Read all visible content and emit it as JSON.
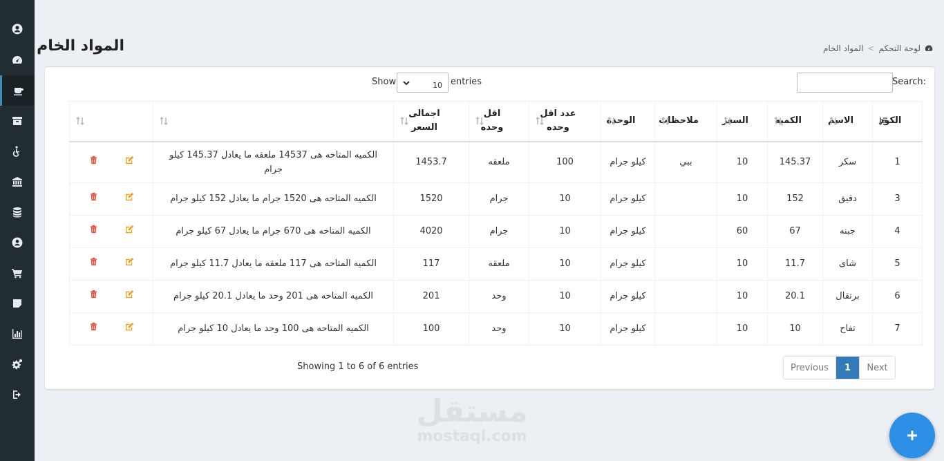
{
  "header": {
    "title": "المواد الخام"
  },
  "breadcrumb": {
    "home": "لوحة التحكم",
    "separator": ">",
    "current": "المواد الخام"
  },
  "sidebar": {
    "items": [
      {
        "icon": "user-circle-icon"
      },
      {
        "icon": "dashboard-icon"
      },
      {
        "icon": "coffee-icon",
        "active": true
      },
      {
        "icon": "archive-icon"
      },
      {
        "icon": "wheelchair-icon"
      },
      {
        "icon": "bank-icon"
      },
      {
        "icon": "database-icon"
      },
      {
        "icon": "user-icon"
      },
      {
        "icon": "cart-icon"
      },
      {
        "icon": "note-icon"
      },
      {
        "icon": "bar-chart-icon"
      },
      {
        "icon": "cogs-icon"
      },
      {
        "icon": "sign-out-icon"
      }
    ]
  },
  "controls": {
    "search_label": "Search:",
    "search_value": "",
    "show_label": "Show",
    "length_value": "10",
    "entries_label": "entries"
  },
  "table": {
    "columns": [
      "الكود",
      "الاسم",
      "الكميه",
      "السعر",
      "ملاحظات",
      "الوحده",
      "عدد اقل وحده",
      "اقل وحده",
      "اجمالى السعر",
      "",
      ""
    ],
    "rows": [
      {
        "code": "1",
        "name": "سكر",
        "qty": "145.37",
        "price": "10",
        "notes": "ببي",
        "unit": "كيلو جرام",
        "min_count": "100",
        "min_unit": "ملعقه",
        "total": "1453.7",
        "desc": "الكميه المتاحه هى 14537 ملعقه ما يعادل 145.37 كيلو جرام"
      },
      {
        "code": "3",
        "name": "دقيق",
        "qty": "152",
        "price": "10",
        "notes": "",
        "unit": "كيلو جرام",
        "min_count": "10",
        "min_unit": "جرام",
        "total": "1520",
        "desc": "الكميه المتاحه هى 1520 جرام ما يعادل 152 كيلو جرام"
      },
      {
        "code": "4",
        "name": "جبنه",
        "qty": "67",
        "price": "60",
        "notes": "",
        "unit": "كيلو جرام",
        "min_count": "10",
        "min_unit": "جرام",
        "total": "4020",
        "desc": "الكميه المتاحه هى 670 جرام ما يعادل 67 كيلو جرام"
      },
      {
        "code": "5",
        "name": "شاى",
        "qty": "11.7",
        "price": "10",
        "notes": "",
        "unit": "كيلو جرام",
        "min_count": "10",
        "min_unit": "ملعقه",
        "total": "117",
        "desc": "الكميه المتاحه هى 117 ملعقه ما يعادل 11.7 كيلو جرام"
      },
      {
        "code": "6",
        "name": "برتقال",
        "qty": "20.1",
        "price": "10",
        "notes": "",
        "unit": "كيلو جرام",
        "min_count": "10",
        "min_unit": "وحد",
        "total": "201",
        "desc": "الكميه المتاحه هى 201 وحد ما يعادل 20.1 كيلو جرام"
      },
      {
        "code": "7",
        "name": "تفاح",
        "qty": "10",
        "price": "10",
        "notes": "",
        "unit": "كيلو جرام",
        "min_count": "10",
        "min_unit": "وحد",
        "total": "100",
        "desc": "الكميه المتاحه هى 100 وحد ما يعادل 10 كيلو جرام"
      }
    ]
  },
  "footer": {
    "info": "Showing 1 to 6 of 6 entries",
    "prev": "Previous",
    "current_page": "1",
    "next": "Next"
  },
  "watermark": {
    "ar": "مستقل",
    "en": "mostaql.com"
  },
  "colors": {
    "sidebar": "#222d32",
    "accent": "#337ab7",
    "fab": "#2e8fe6",
    "edit": "#f39c12",
    "delete": "#dd4b39"
  }
}
